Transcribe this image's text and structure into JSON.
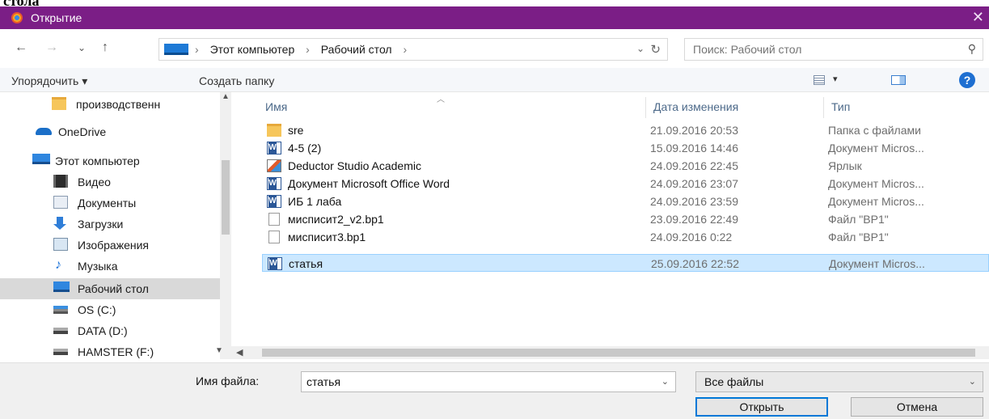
{
  "page_caption_fragment": "стола",
  "window": {
    "title": "Открытие",
    "close_glyph": "✕"
  },
  "nav": {
    "back": "←",
    "forward": "→",
    "recent": "⌄",
    "up": "↑"
  },
  "address": {
    "crumbs": [
      "Этот компьютер",
      "Рабочий стол"
    ],
    "separator": "›",
    "dropdown": "⌄",
    "refresh": "↻"
  },
  "search": {
    "placeholder": "Поиск: Рабочий стол",
    "icon": "⚲"
  },
  "toolbar": {
    "organize": "Упорядочить ▾",
    "new_folder": "Создать папку",
    "view_dropdown": "▾",
    "help": "?"
  },
  "sidebar": {
    "items": [
      {
        "label": "производственн",
        "icon": "folder-icon"
      },
      {
        "label": "OneDrive",
        "icon": "onedrive-icon"
      },
      {
        "label": "Этот компьютер",
        "icon": "computer-icon"
      },
      {
        "label": "Видео",
        "icon": "video-icon"
      },
      {
        "label": "Документы",
        "icon": "documents-icon"
      },
      {
        "label": "Загрузки",
        "icon": "downloads-icon"
      },
      {
        "label": "Изображения",
        "icon": "pictures-icon"
      },
      {
        "label": "Музыка",
        "icon": "music-icon"
      },
      {
        "label": "Рабочий стол",
        "icon": "desktop-icon",
        "selected": true
      },
      {
        "label": "OS (C:)",
        "icon": "drive-c-icon"
      },
      {
        "label": "DATA (D:)",
        "icon": "drive-icon"
      },
      {
        "label": "HAMSTER (F:)",
        "icon": "drive-icon"
      }
    ]
  },
  "columns": {
    "name": "Имя",
    "date": "Дата изменения",
    "type": "Тип"
  },
  "files": [
    {
      "name": "sre",
      "date": "21.09.2016 20:53",
      "type": "Папка с файлами",
      "icon": "folder"
    },
    {
      "name": "4-5 (2)",
      "date": "15.09.2016 14:46",
      "type": "Документ Micros...",
      "icon": "word"
    },
    {
      "name": "Deductor Studio Academic",
      "date": "24.09.2016 22:45",
      "type": "Ярлык",
      "icon": "shortcut"
    },
    {
      "name": "Документ Microsoft Office Word",
      "date": "24.09.2016 23:07",
      "type": "Документ Micros...",
      "icon": "word"
    },
    {
      "name": "ИБ 1 лаба",
      "date": "24.09.2016 23:59",
      "type": "Документ Micros...",
      "icon": "word"
    },
    {
      "name": "мисписит2_v2.bp1",
      "date": "23.09.2016 22:49",
      "type": "Файл \"BP1\"",
      "icon": "file"
    },
    {
      "name": "мисписит3.bp1",
      "date": "24.09.2016 0:22",
      "type": "Файл \"BP1\"",
      "icon": "file"
    },
    {
      "name": "статья",
      "date": "25.09.2016 22:52",
      "type": "Документ Micros...",
      "icon": "word",
      "selected": true
    }
  ],
  "footer": {
    "filename_label": "Имя файла:",
    "filename_value": "статья",
    "filter_value": "Все файлы",
    "open_button": "Открыть",
    "cancel_button": "Отмена"
  },
  "colors": {
    "titlebar": "#7b1e86",
    "selection": "#cce8ff",
    "accent": "#0078d7"
  }
}
